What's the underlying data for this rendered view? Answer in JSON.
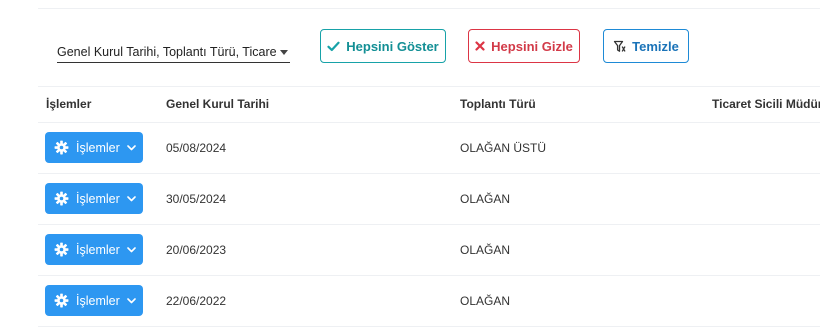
{
  "toolbar": {
    "column_select_value": "Genel Kurul Tarihi, Toplantı Türü, Ticaret Sic...",
    "show_all_label": "Hepsini Göster",
    "hide_all_label": "Hepsini Gizle",
    "clear_label": "Temizle"
  },
  "table": {
    "headers": [
      "İşlemler",
      "Genel Kurul Tarihi",
      "Toplantı Türü",
      "Ticaret Sicili Müdürlüğü"
    ],
    "action_label": "İşlemler",
    "rows": [
      {
        "date": "05/08/2024",
        "type": "OLAĞAN ÜSTÜ"
      },
      {
        "date": "30/05/2024",
        "type": "OLAĞAN"
      },
      {
        "date": "20/06/2023",
        "type": "OLAĞAN"
      },
      {
        "date": "22/06/2022",
        "type": "OLAĞAN"
      }
    ]
  },
  "colors": {
    "action_button": "#2d97f1",
    "show_all": "#17a2a8",
    "hide_all": "#dc3545",
    "clear": "#1e8ad6"
  },
  "icons": {
    "show_all": "check-icon",
    "hide_all": "x-icon",
    "clear": "filter-clear-icon",
    "action": "gear-icon",
    "action_caret": "chevron-down-icon"
  }
}
